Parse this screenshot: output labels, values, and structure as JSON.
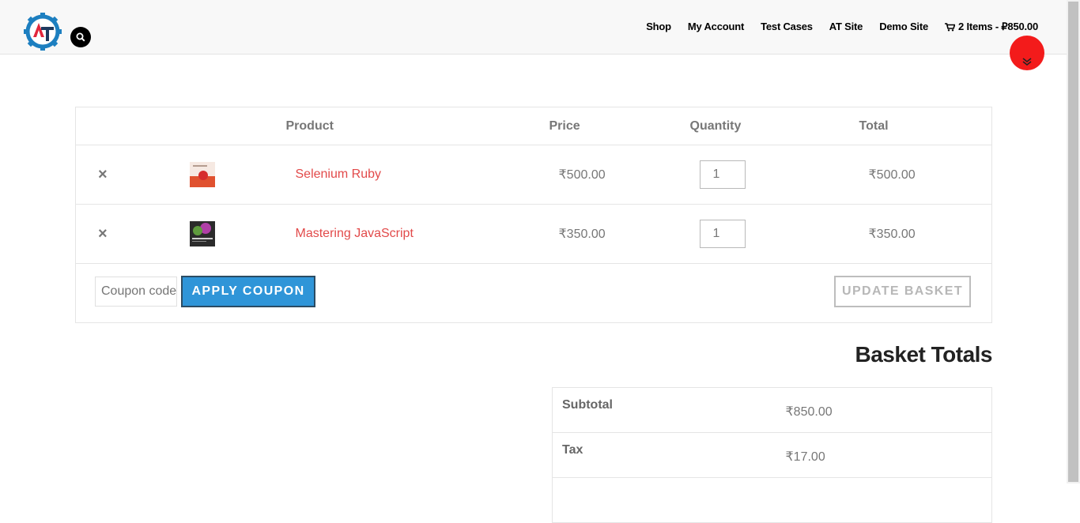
{
  "header": {
    "nav": [
      "Shop",
      "My Account",
      "Test Cases",
      "AT Site",
      "Demo Site"
    ],
    "cart_label": "2 Items - ₽850.00"
  },
  "cart": {
    "columns": [
      "",
      "",
      "Product",
      "Price",
      "Quantity",
      "Total"
    ],
    "items": [
      {
        "name": "Selenium Ruby",
        "price": "₹500.00",
        "qty": "1",
        "total": "₹500.00"
      },
      {
        "name": "Mastering JavaScript",
        "price": "₹350.00",
        "qty": "1",
        "total": "₹350.00"
      }
    ],
    "remove_symbol": "×",
    "coupon_placeholder": "Coupon code",
    "apply_label": "APPLY COUPON",
    "update_label": "UPDATE BASKET"
  },
  "totals": {
    "title": "Basket Totals",
    "rows": [
      {
        "label": "Subtotal",
        "value": "₹850.00"
      },
      {
        "label": "Tax",
        "value": "₹17.00"
      }
    ]
  },
  "colors": {
    "accent": "#2f95d8",
    "product_link": "#e24a4a",
    "scroll_button": "#f31b1b"
  }
}
